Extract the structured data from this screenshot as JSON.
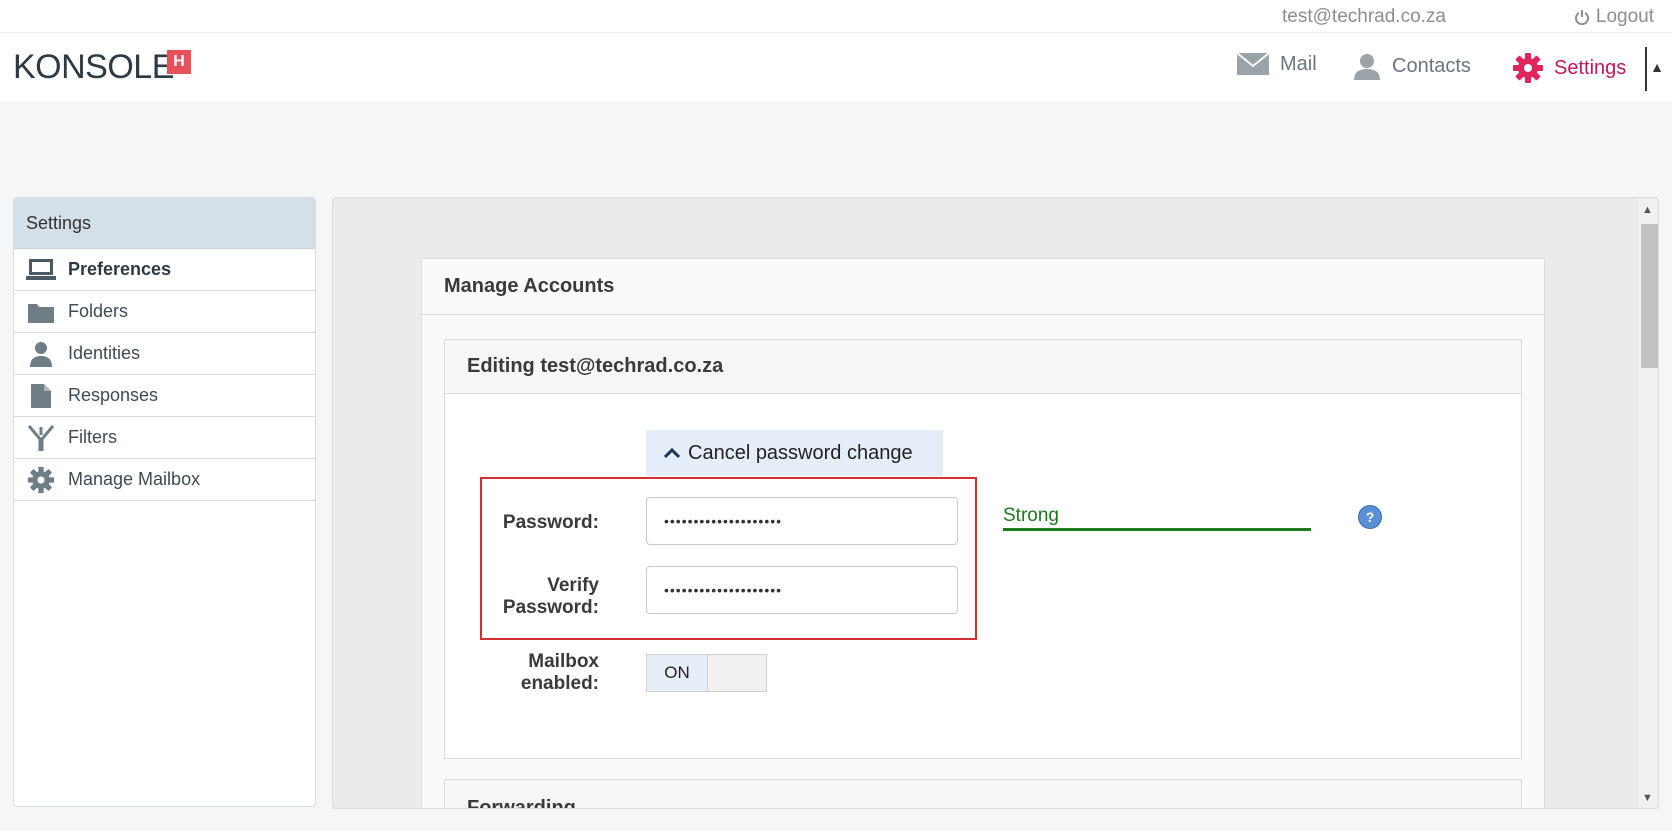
{
  "header": {
    "user_email": "test@techrad.co.za",
    "logout_label": "Logout",
    "logo_text": "KONSOLE",
    "logo_badge": "H",
    "nav": [
      {
        "label": "Mail",
        "icon": "mail-icon"
      },
      {
        "label": "Contacts",
        "icon": "contact-icon"
      },
      {
        "label": "Settings",
        "icon": "gear-icon",
        "active": true
      }
    ]
  },
  "sidebar": {
    "title": "Settings",
    "items": [
      {
        "label": "Preferences",
        "icon": "monitor-icon",
        "active": true
      },
      {
        "label": "Folders",
        "icon": "folder-icon"
      },
      {
        "label": "Identities",
        "icon": "person-icon"
      },
      {
        "label": "Responses",
        "icon": "document-icon"
      },
      {
        "label": "Filters",
        "icon": "filter-icon"
      },
      {
        "label": "Manage Mailbox",
        "icon": "gear-icon"
      }
    ]
  },
  "main": {
    "panel_title": "Manage Accounts",
    "editing_title": "Editing test@techrad.co.za",
    "cancel_password_label": "Cancel password change",
    "password_label": "Password:",
    "password_value": "••••••••••••••••••••",
    "verify_label_1": "Verify",
    "verify_label_2": "Password:",
    "verify_value": "••••••••••••••••••••",
    "strength_label": "Strong",
    "help_label": "?",
    "mailbox_label_1": "Mailbox",
    "mailbox_label_2": "enabled:",
    "mailbox_toggle": "ON",
    "next_section_title": "Forwarding"
  },
  "colors": {
    "accent": "#c0185c",
    "strength_green": "#1c7a1c",
    "highlight_red": "#d32f2f",
    "badge_red": "#e8505b"
  }
}
